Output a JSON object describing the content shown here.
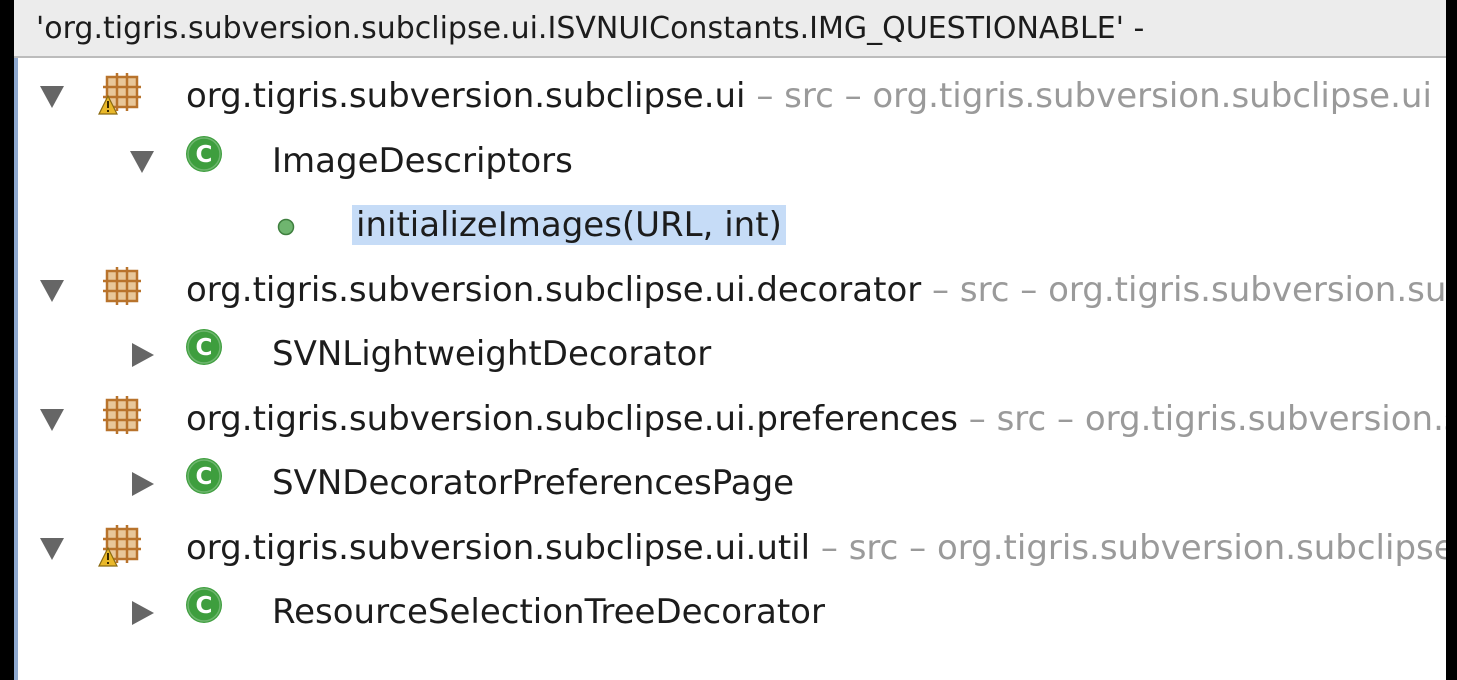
{
  "title": "'org.tigris.subversion.subclipse.ui.ISVNUIConstants.IMG_QUESTIONABLE' -",
  "colors": {
    "selection": "#c6dcf7",
    "class_icon": "#3e9e3e",
    "package_icon": "#b8732c",
    "warning_overlay": "#e9b82a",
    "qualifier_text": "#9a9a9a"
  },
  "tree": {
    "nodes": [
      {
        "level": 0,
        "type": "package",
        "icon": "package-warning-icon",
        "expanded": true,
        "label": "org.tigris.subversion.subclipse.ui",
        "qualifier": " – src – org.tigris.subversion.subclipse.ui"
      },
      {
        "level": 1,
        "type": "class",
        "icon": "class-icon",
        "expanded": true,
        "label": "ImageDescriptors",
        "qualifier": ""
      },
      {
        "level": 2,
        "type": "method",
        "icon": "method-icon",
        "expanded": null,
        "selected": true,
        "label": "initializeImages(URL, int)",
        "qualifier": ""
      },
      {
        "level": 0,
        "type": "package",
        "icon": "package-icon",
        "expanded": true,
        "label": "org.tigris.subversion.subclipse.ui.decorator",
        "qualifier": " – src – org.tigris.subversion.subclipse.ui"
      },
      {
        "level": 1,
        "type": "class",
        "icon": "class-icon",
        "expanded": false,
        "label": "SVNLightweightDecorator",
        "qualifier": ""
      },
      {
        "level": 0,
        "type": "package",
        "icon": "package-icon",
        "expanded": true,
        "label": "org.tigris.subversion.subclipse.ui.preferences",
        "qualifier": " – src – org.tigris.subversion.subclipse.ui"
      },
      {
        "level": 1,
        "type": "class",
        "icon": "class-icon",
        "expanded": false,
        "label": "SVNDecoratorPreferencesPage",
        "qualifier": ""
      },
      {
        "level": 0,
        "type": "package",
        "icon": "package-warning-icon",
        "expanded": true,
        "label": "org.tigris.subversion.subclipse.ui.util",
        "qualifier": " – src – org.tigris.subversion.subclipse.ui"
      },
      {
        "level": 1,
        "type": "class",
        "icon": "class-icon",
        "expanded": false,
        "label": "ResourceSelectionTreeDecorator",
        "qualifier": ""
      }
    ]
  }
}
